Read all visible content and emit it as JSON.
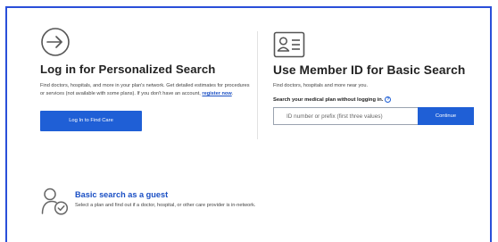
{
  "login": {
    "title": "Log in for Personalized Search",
    "description": "Find doctors, hospitals, and more in your plan's network. Get detailed estimates for procedures or services (not available with some plans). If you don't have an account,",
    "register_link": "register now",
    "button_label": "Log In to Find Care"
  },
  "member_id": {
    "title": "Use Member ID for Basic Search",
    "description": "Find doctors, hospitals and more near you.",
    "search_label": "Search your medical plan without logging in.",
    "input_placeholder": "ID number or prefix (first three values)",
    "input_value": "",
    "continue_label": "Continue"
  },
  "guest": {
    "title": "Basic search as a guest",
    "description": "Select a plan and find out if a doctor, hospital, or other care provider is in-network."
  },
  "colors": {
    "accent": "#1f5fd6",
    "link": "#1a4fc4",
    "frame_border": "#2a4fd9"
  },
  "icons": {
    "login": "arrow-right-circle-icon",
    "member_id": "id-card-icon",
    "help": "question-circle-icon",
    "guest": "user-check-icon"
  }
}
